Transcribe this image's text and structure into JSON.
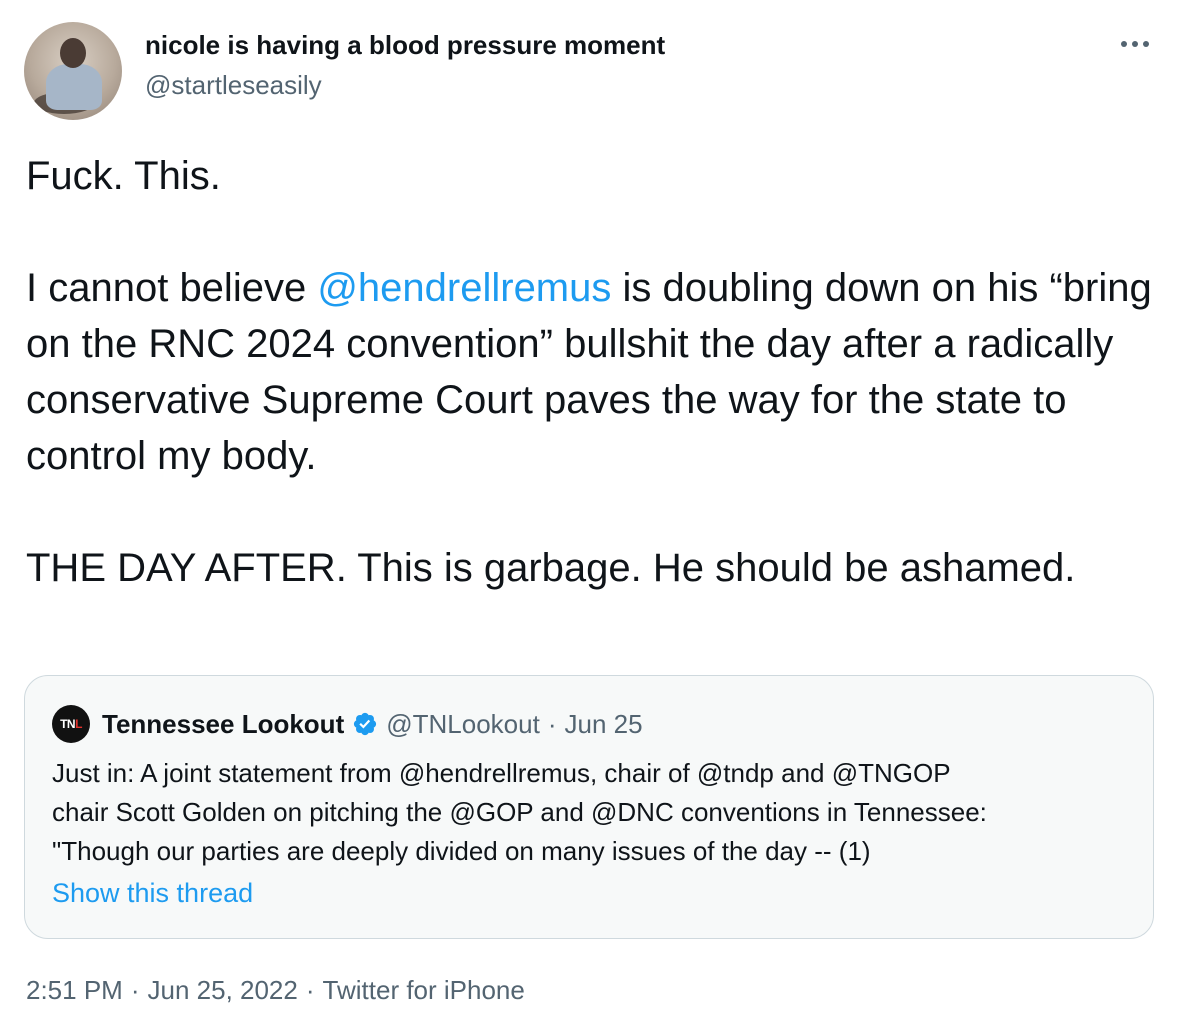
{
  "author": {
    "display_name": "nicole is having a blood pressure moment",
    "handle": "@startleseasily"
  },
  "tweet": {
    "line1": "Fuck. This.",
    "p2_before": "I cannot believe ",
    "p2_mention": "@hendrellremus",
    "p2_after": " is doubling down on his “bring on the RNC 2024 convention” bullshit the day after a radically conservative Supreme Court paves the way for the state to control my body.",
    "p3": "THE DAY AFTER. This is garbage. He should be ashamed."
  },
  "quoted": {
    "avatar_text_a": "TN",
    "avatar_text_b": "L",
    "name": "Tennessee Lookout",
    "handle": "@TNLookout",
    "separator": "·",
    "date": "Jun 25",
    "lines": [
      "Just in: A joint statement from @hendrellremus, chair of @tndp and @TNGOP",
      "chair Scott Golden on pitching the @GOP and @DNC conventions in Tennessee:",
      "\"Though our parties are deeply divided on many issues of the day -- (1)"
    ],
    "show_thread": "Show this thread"
  },
  "meta": {
    "time": "2:51 PM",
    "separator": "·",
    "date": "Jun 25, 2022",
    "source": "Twitter for iPhone"
  },
  "colors": {
    "link": "#1d9bf0",
    "text": "#0f1419",
    "secondary": "#536471",
    "card_bg": "#f7f9f9",
    "card_border": "#cfd9de"
  },
  "icons": {
    "more": "more-horizontal-icon",
    "verified": "verified-badge-icon"
  }
}
